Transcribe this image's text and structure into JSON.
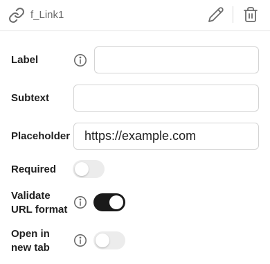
{
  "header": {
    "field_name": "f_Link1",
    "link_icon": "link-icon",
    "edit_icon": "pencil-icon",
    "delete_icon": "trash-icon"
  },
  "form": {
    "label": {
      "text": "Label",
      "value": "",
      "info_icon": "info-icon"
    },
    "subtext": {
      "text": "Subtext",
      "value": ""
    },
    "placeholder": {
      "text": "Placeholder",
      "value": "https://example.com"
    },
    "required": {
      "text": "Required",
      "enabled": false
    },
    "validate_url": {
      "text_line1": "Validate",
      "text_line2": "URL format",
      "enabled": true,
      "info_icon": "info-icon"
    },
    "open_new_tab": {
      "text_line1": "Open in",
      "text_line2": "new tab",
      "enabled": false,
      "info_icon": "info-icon"
    }
  },
  "colors": {
    "toggle_on": "#1a1a1a",
    "toggle_off": "#ececec",
    "border": "#d4d4d4",
    "icon": "#6b6b6b"
  }
}
